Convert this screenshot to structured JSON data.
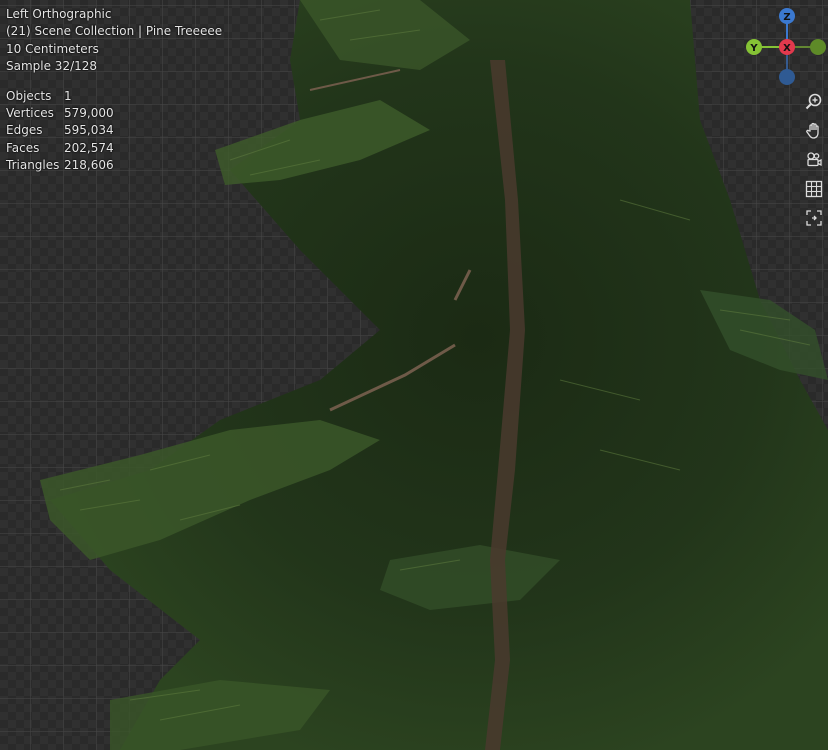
{
  "viewport": {
    "view_name": "Left Orthographic",
    "collection_line": "(21) Scene Collection | Pine Treeeee",
    "scale": "10 Centimeters",
    "sample": "Sample 32/128",
    "stats": [
      {
        "label": "Objects",
        "value": "1"
      },
      {
        "label": "Vertices",
        "value": "579,000"
      },
      {
        "label": "Edges",
        "value": "595,034"
      },
      {
        "label": "Faces",
        "value": "202,574"
      },
      {
        "label": "Triangles",
        "value": "218,606"
      }
    ]
  },
  "gizmo": {
    "z_label": "Z",
    "y_label": "Y",
    "x_label": "X",
    "colors": {
      "x": "#e2394d",
      "y": "#85c235",
      "z": "#3b79d0"
    }
  },
  "tools": [
    {
      "icon": "zoom-icon"
    },
    {
      "icon": "hand-pan-icon"
    },
    {
      "icon": "camera-view-icon"
    },
    {
      "icon": "grid-ortho-icon"
    },
    {
      "icon": "local-view-icon"
    }
  ]
}
